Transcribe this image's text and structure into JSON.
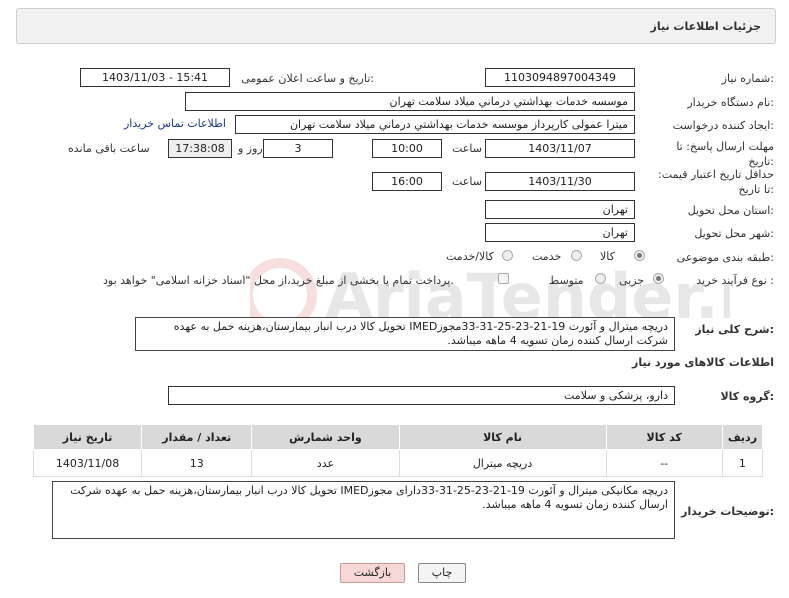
{
  "header": {
    "title": "جزئیات اطلاعات نیاز"
  },
  "fields": {
    "need_number_label": "شماره نیاز:",
    "need_number": "1103094897004349",
    "announce_label": "تاریخ و ساعت اعلان عمومی:",
    "announce_value": "1403/11/03 - 15:41",
    "buyer_org_label": "نام دستگاه خریدار:",
    "buyer_org": "موسسه خدمات بهداشتي درماني ميلاد سلامت تهران",
    "requester_label": "ایجاد کننده درخواست:",
    "requester": "میترا عمولی کارپرداز موسسه خدمات بهداشتي درماني ميلاد سلامت تهران",
    "buyer_contact_link": "اطلاعات تماس خریدار",
    "deadline_label": "مهلت ارسال پاسخ: تا تاریخ:",
    "deadline_date": "1403/11/07",
    "time_label": "ساعت",
    "deadline_time": "10:00",
    "days_value": "3",
    "days_label": "روز و",
    "remaining_time": "17:38:08",
    "remaining_label": "ساعت باقی مانده",
    "validity_label": "حداقل تاریخ اعتبار قیمت: تا تاریخ:",
    "validity_date": "1403/11/30",
    "validity_time": "16:00",
    "province_label": "استان محل تحویل:",
    "province": "تهران",
    "city_label": "شهر محل تحویل:",
    "city": "تهران",
    "category_label": "طبقه بندی موضوعی:",
    "category_options": [
      "کالا",
      "خدمت",
      "کالا/خدمت"
    ],
    "process_label": "نوع فرآیند خرید :",
    "process_options": [
      "جزیی",
      "متوسط"
    ],
    "payment_note": "پرداخت تمام یا بخشی از مبلغ خرید،از محل \"اسناد خزانه اسلامی\" خواهد بود."
  },
  "description": {
    "label": "شرح کلی نیاز:",
    "text": "دریچه  میترال و آئورت 19-21-23-25-31-33مجوزIMED تحویل کالا درب انبار بیمارستان،هزینه حمل به عهده شرکت ارسال کننده زمان تسویه 4 ماهه میباشد."
  },
  "goods_info": {
    "title": "اطلاعات کالاهای مورد نیاز"
  },
  "goods_group": {
    "label": "گروه کالا:",
    "value": "دارو، پزشکی و سلامت"
  },
  "table": {
    "headers": [
      "ردیف",
      "کد کالا",
      "نام کالا",
      "واحد شمارش",
      "تعداد / مقدار",
      "تاریخ نیاز"
    ],
    "rows": [
      [
        "1",
        "--",
        "دریچه میترال",
        "عدد",
        "13",
        "1403/11/08"
      ]
    ]
  },
  "buyer_notes": {
    "label": "توضیحات خریدار:",
    "text": "دریچه مکانیکی میترال و آئورت 19-21-23-25-31-33دارای مجوزIMED تحویل کالا درب انبار بیمارستان،هزینه حمل به عهده شرکت ارسال کننده زمان تسویه 4 ماهه میباشد."
  },
  "buttons": {
    "print": "چاپ",
    "back": "بازگشت"
  },
  "watermark_text": "AriaTender.neT",
  "colors": {
    "link": "#1a3a8a",
    "back_button_bg": "#f8d7d7",
    "header_bg": "#f2f2f2"
  }
}
